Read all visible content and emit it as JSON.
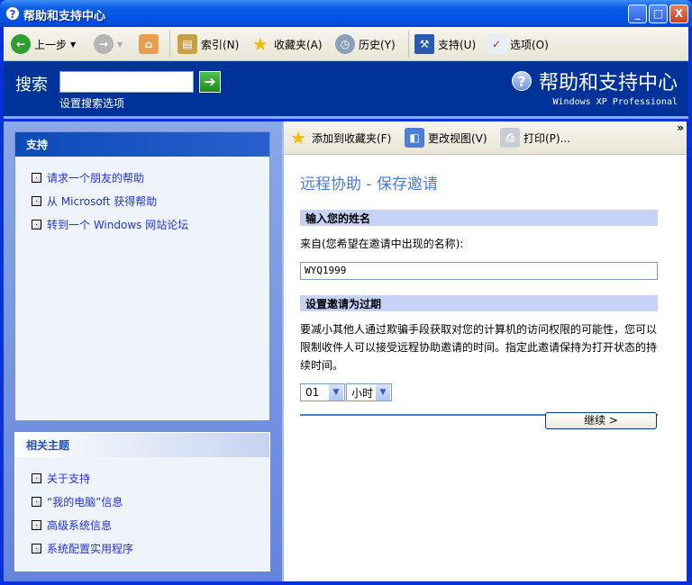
{
  "window": {
    "title": "帮助和支持中心",
    "minimize": "_",
    "maximize": "□",
    "close": "X"
  },
  "toolbar": {
    "back": "上一步",
    "index": "索引(N)",
    "favorites": "收藏夹(A)",
    "history": "历史(Y)",
    "support": "支持(U)",
    "options": "选项(O)"
  },
  "search": {
    "label": "搜索",
    "value": "",
    "options_link": "设置搜索选项",
    "brand": "帮助和支持中心",
    "brand_sub": "Windows XP Professional"
  },
  "left": {
    "support_title": "支持",
    "support_links": [
      "请求一个朋友的帮助",
      "从 Microsoft 获得帮助",
      "转到一个 Windows 网站论坛"
    ],
    "related_title": "相关主题",
    "related_links": [
      "关于支持",
      "“我的电脑”信息",
      "高级系统信息",
      "系统配置实用程序"
    ]
  },
  "content_toolbar": {
    "add_fav": "添加到收藏夹(F)",
    "change_view": "更改视图(V)",
    "print": "打印(P)...",
    "more": "»"
  },
  "content": {
    "heading": "远程协助 - 保存邀请",
    "section1": "输入您的姓名",
    "from_label": "来自(您希望在邀请中出现的名称):",
    "name_value": "WYQ1999",
    "section2": "设置邀请为过期",
    "description": "要减小其他人通过欺骗手段获取对您的计算机的访问权限的可能性，您可以限制收件人可以接受远程协助邀请的时间。指定此邀请保持为打开状态的持续时间。",
    "duration_value": "01",
    "duration_unit": "小时",
    "continue": "继续 >"
  }
}
